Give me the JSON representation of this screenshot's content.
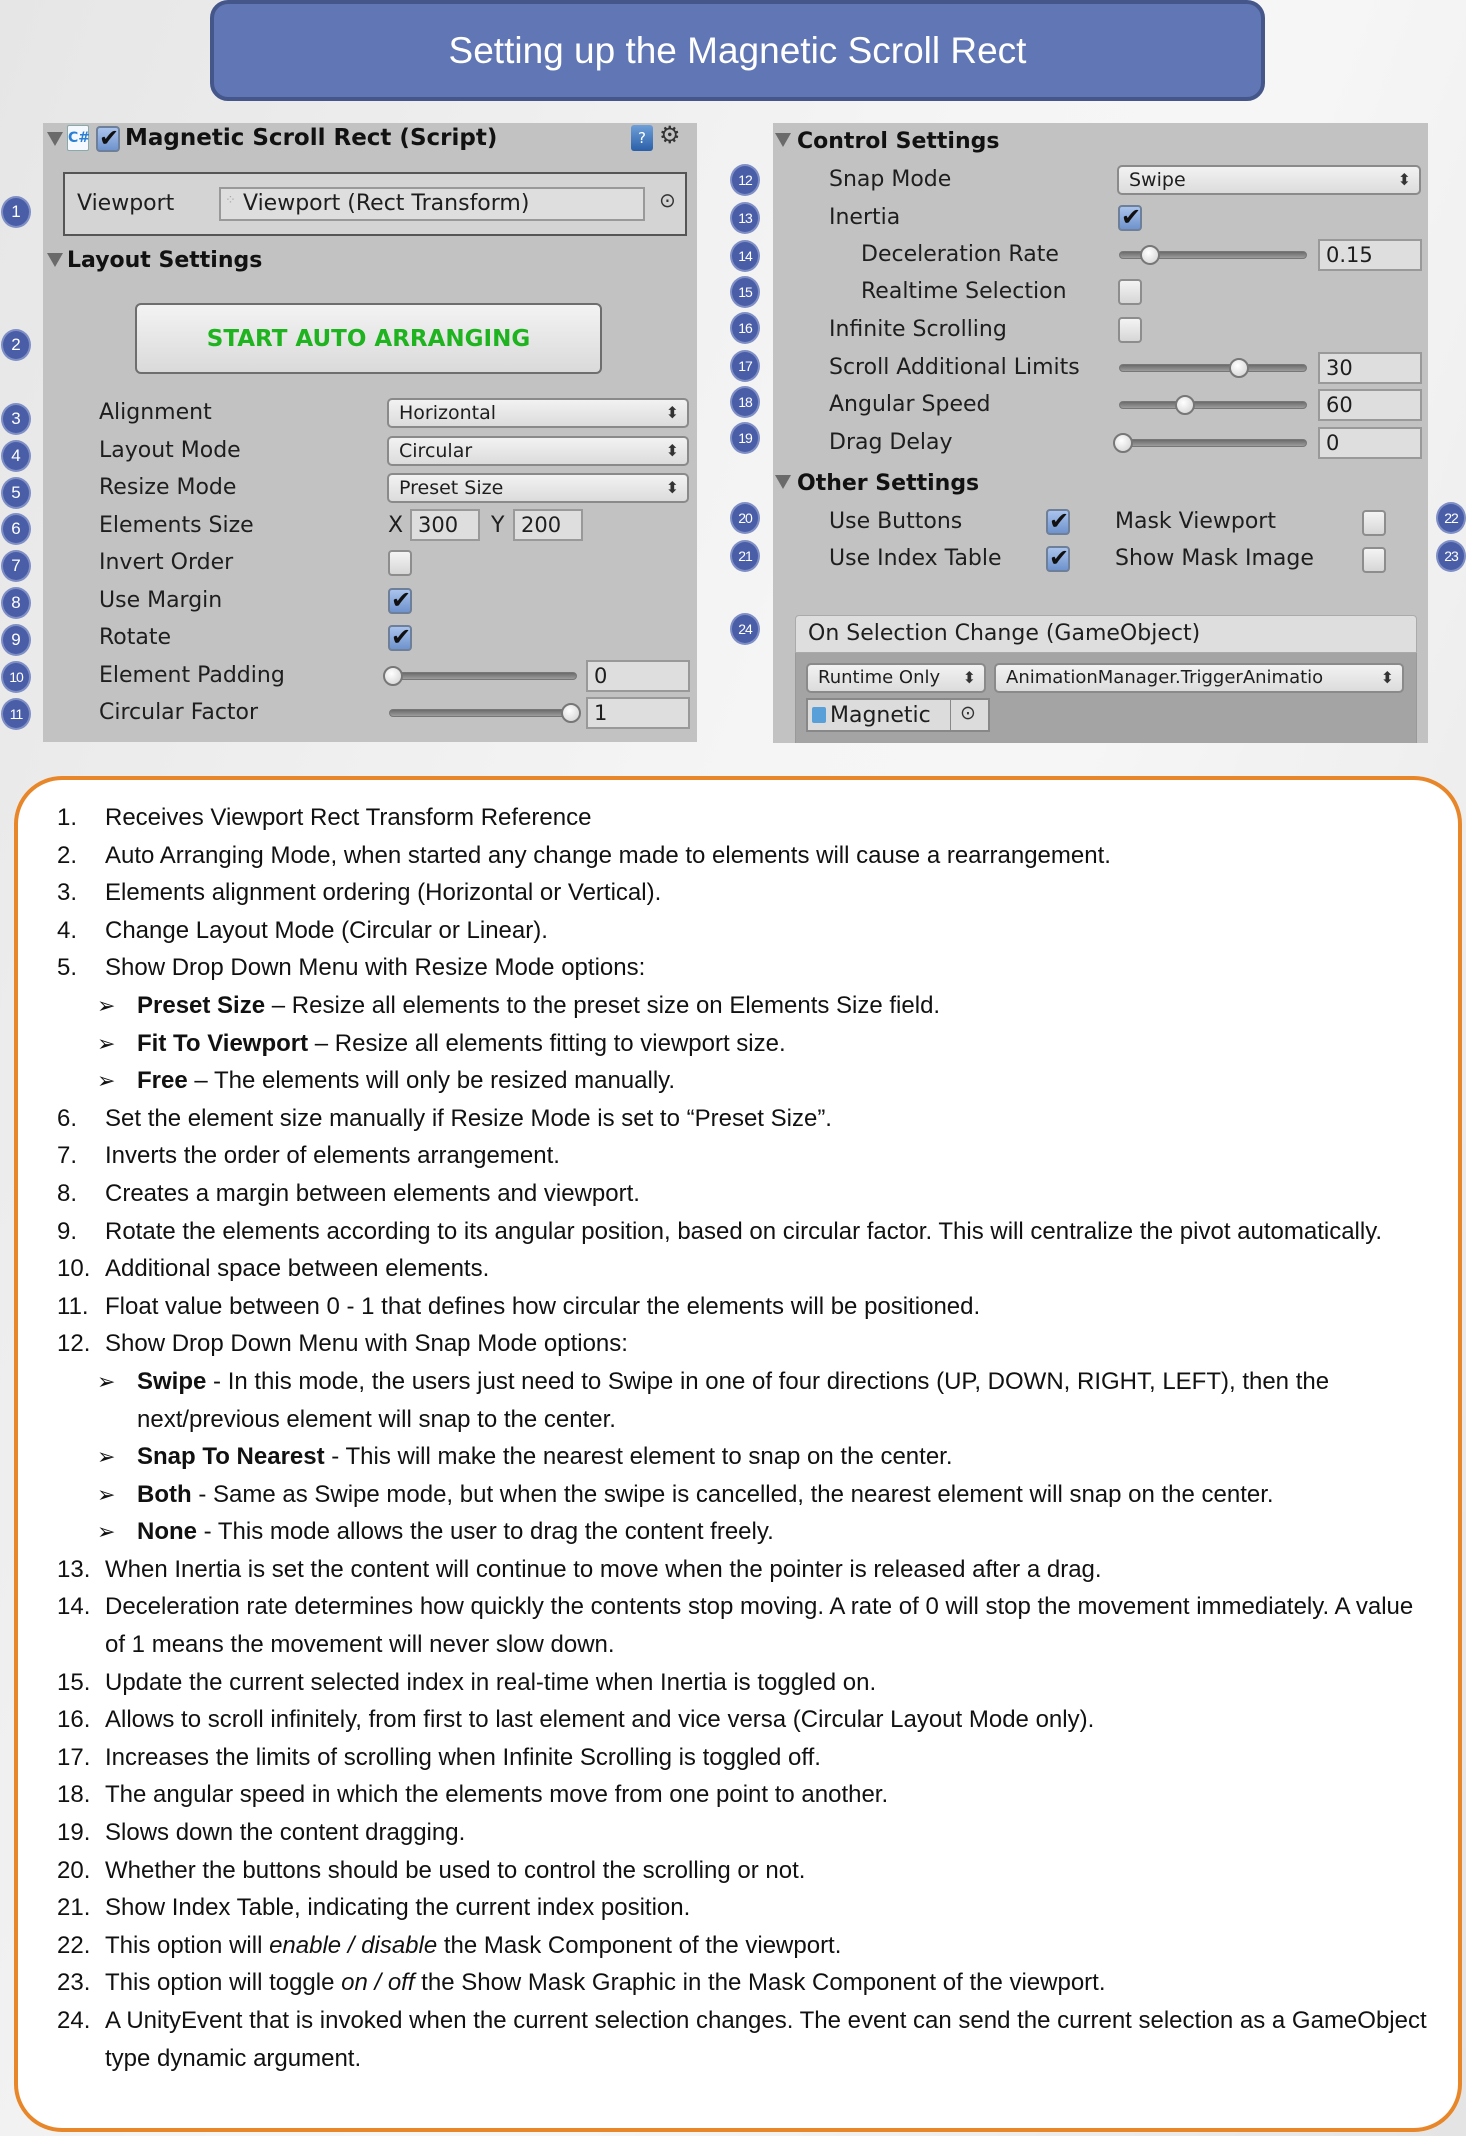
{
  "title": "Setting up the Magnetic Scroll Rect",
  "left_panel": {
    "component_title": "Magnetic Scroll Rect (Script)",
    "component_enabled": true,
    "icons": [
      "csharp-script-icon",
      "help-book-icon",
      "gear-icon"
    ],
    "viewport": {
      "label": "Viewport",
      "value": "Viewport (Rect Transform)"
    },
    "layout_settings_header": "Layout Settings",
    "start_button_label": "START AUTO ARRANGING",
    "start_button_color": "#1fb31f",
    "fields": {
      "alignment": {
        "label": "Alignment",
        "value": "Horizontal"
      },
      "layout_mode": {
        "label": "Layout Mode",
        "value": "Circular"
      },
      "resize_mode": {
        "label": "Resize Mode",
        "value": "Preset Size"
      },
      "elements_size": {
        "label": "Elements Size",
        "x_label": "X",
        "x": "300",
        "y_label": "Y",
        "y": "200"
      },
      "invert_order": {
        "label": "Invert Order",
        "checked": false
      },
      "use_margin": {
        "label": "Use Margin",
        "checked": true
      },
      "rotate": {
        "label": "Rotate",
        "checked": true
      },
      "element_padding": {
        "label": "Element Padding",
        "value": "0",
        "slider_fraction": 0.0
      },
      "circular_factor": {
        "label": "Circular Factor",
        "value": "1",
        "slider_fraction": 1.0
      }
    }
  },
  "right_panel": {
    "control_settings_header": "Control Settings",
    "fields": {
      "snap_mode": {
        "label": "Snap Mode",
        "value": "Swipe"
      },
      "inertia": {
        "label": "Inertia",
        "checked": true
      },
      "deceleration_rate": {
        "label": "Deceleration Rate",
        "value": "0.15",
        "slider_fraction": 0.15
      },
      "realtime_selection": {
        "label": "Realtime Selection",
        "checked": false
      },
      "infinite_scrolling": {
        "label": "Infinite Scrolling",
        "checked": false
      },
      "scroll_additional_limits": {
        "label": "Scroll Additional Limits",
        "value": "30",
        "slider_fraction": 0.65
      },
      "angular_speed": {
        "label": "Angular Speed",
        "value": "60",
        "slider_fraction": 0.35
      },
      "drag_delay": {
        "label": "Drag Delay",
        "value": "0",
        "slider_fraction": 0.0
      }
    },
    "other_settings_header": "Other Settings",
    "other": {
      "use_buttons": {
        "label": "Use Buttons",
        "checked": true
      },
      "use_index_table": {
        "label": "Use Index Table",
        "checked": true
      },
      "mask_viewport": {
        "label": "Mask Viewport",
        "checked": false
      },
      "show_mask_image": {
        "label": "Show Mask Image",
        "checked": false
      }
    },
    "event": {
      "title": "On Selection Change (GameObject)",
      "runtime": "Runtime Only",
      "function": "AnimationManager.TriggerAnimatio",
      "object": "Magnetic"
    }
  },
  "markers": [
    "1",
    "2",
    "3",
    "4",
    "5",
    "6",
    "7",
    "8",
    "9",
    "10",
    "11",
    "12",
    "13",
    "14",
    "15",
    "16",
    "17",
    "18",
    "19",
    "20",
    "21",
    "22",
    "23",
    "24"
  ],
  "descriptions": [
    {
      "num": "1.",
      "text": "Receives Viewport Rect Transform Reference"
    },
    {
      "num": "2.",
      "text": "Auto Arranging Mode, when started any change made to elements will cause a rearrangement."
    },
    {
      "num": "3.",
      "text": "Elements alignment ordering (Horizontal or Vertical)."
    },
    {
      "num": "4.",
      "text": "Change Layout Mode (Circular or Linear)."
    },
    {
      "num": "5.",
      "text": "Show Drop Down Menu with Resize Mode options:",
      "sub": [
        {
          "term": "Preset Size",
          "text": " – Resize all elements to the preset size on Elements Size field."
        },
        {
          "term": "Fit To Viewport",
          "text": " – Resize all elements fitting to viewport size."
        },
        {
          "term": "Free",
          "text": " – The elements will only be resized manually."
        }
      ]
    },
    {
      "num": "6.",
      "text": "Set the element size manually if Resize Mode is set to “Preset Size”."
    },
    {
      "num": "7.",
      "text": "Inverts the order of elements arrangement."
    },
    {
      "num": "8.",
      "text": "Creates a margin between elements and viewport."
    },
    {
      "num": "9.",
      "text": "Rotate the elements according to its angular position, based on circular factor. This will centralize the pivot automatically."
    },
    {
      "num": "10.",
      "text": "Additional space between elements."
    },
    {
      "num": "11.",
      "text": "Float value between 0 - 1 that defines how circular the elements will be positioned."
    },
    {
      "num": "12.",
      "text": "Show Drop Down Menu with Snap Mode options:",
      "sub": [
        {
          "term": "Swipe",
          "text": " - In this mode, the users just need to Swipe in one of four directions (UP, DOWN, RIGHT, LEFT), then the next/previous element will snap to the center."
        },
        {
          "term": "Snap To Nearest",
          "text": " - This will make the nearest element to snap on the center."
        },
        {
          "term": "Both",
          "text": " - Same as Swipe mode, but when the swipe is cancelled, the nearest element will snap on the center."
        },
        {
          "term": "None",
          "text": " - This mode allows the user to drag the content freely."
        }
      ]
    },
    {
      "num": "13.",
      "text": "When Inertia is set the content will continue to move when the pointer is released after a drag."
    },
    {
      "num": "14.",
      "text": "Deceleration rate determines how quickly the contents stop moving. A rate of 0 will stop the movement immediately. A value of 1 means the movement will never slow down."
    },
    {
      "num": "15.",
      "text": "Update the current selected index in real-time when Inertia is toggled on."
    },
    {
      "num": "16.",
      "text": "Allows to scroll infinitely, from first to last element and vice versa (Circular Layout Mode only)."
    },
    {
      "num": "17.",
      "text": "Increases the limits of scrolling when Infinite Scrolling is toggled off."
    },
    {
      "num": "18.",
      "text": "The angular speed in which the elements move from one point to another."
    },
    {
      "num": "19.",
      "text": "Slows down the content dragging."
    },
    {
      "num": "20.",
      "text": "Whether the buttons should be used  to control the scrolling or not."
    },
    {
      "num": "21.",
      "text": "Show Index Table, indicating the current index position."
    },
    {
      "num": "22.",
      "pre": "This option will  ",
      "em": "enable / disable ",
      "text": " the Mask Component of the viewport."
    },
    {
      "num": "23.",
      "pre": "This option will toggle  ",
      "em": "on / off",
      "text": "  the Show Mask Graphic in the Mask Component of the viewport."
    },
    {
      "num": "24.",
      "text": "A UnityEvent that is invoked when the current selection changes. The event can send the current selection as a GameObject type dynamic argument."
    }
  ]
}
